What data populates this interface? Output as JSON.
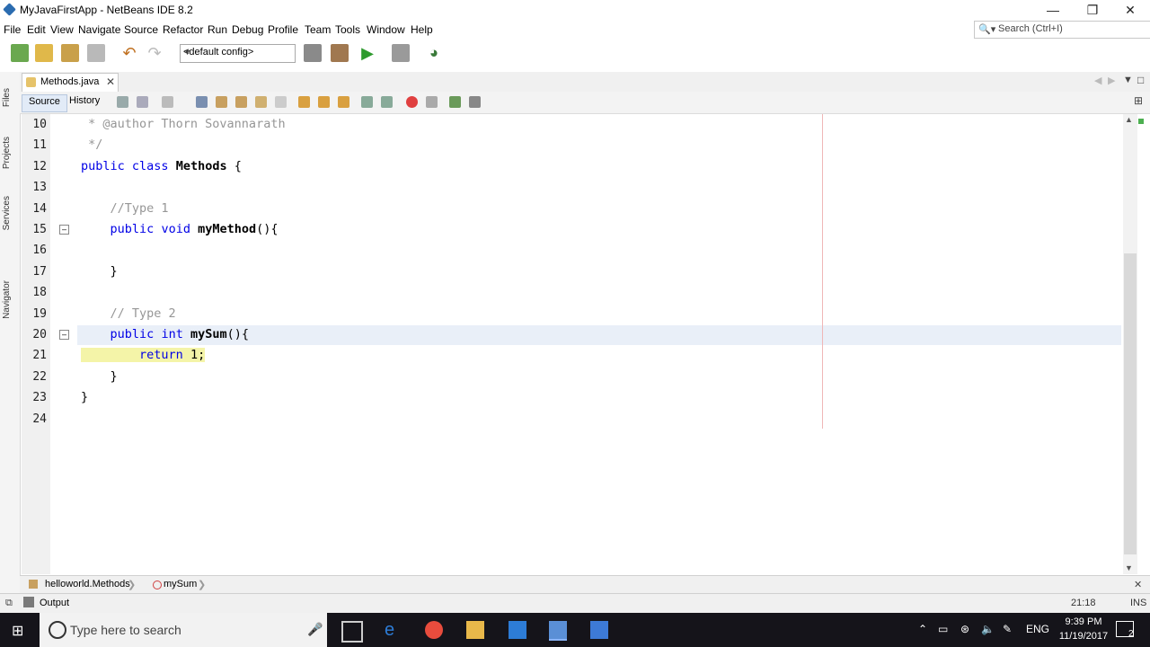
{
  "window": {
    "title": "MyJavaFirstApp - NetBeans IDE 8.2"
  },
  "menu": [
    "File",
    "Edit",
    "View",
    "Navigate",
    "Source",
    "Refactor",
    "Run",
    "Debug",
    "Profile",
    "Team",
    "Tools",
    "Window",
    "Help"
  ],
  "search": {
    "placeholder": "Search (Ctrl+I)"
  },
  "toolbar": {
    "config_value": "<default config>"
  },
  "side_panels": [
    "Files",
    "Projects",
    "Services",
    "Navigator"
  ],
  "editor": {
    "tab_label": "Methods.java",
    "source_tab": "Source",
    "history_tab": "History",
    "lines": [
      {
        "num": "10",
        "text": " * @author Thorn Sovannarath"
      },
      {
        "num": "11",
        "text": " */"
      },
      {
        "num": "12",
        "text": "public class Methods {"
      },
      {
        "num": "13",
        "text": ""
      },
      {
        "num": "14",
        "text": "    //Type 1"
      },
      {
        "num": "15",
        "text": "    public void myMethod(){"
      },
      {
        "num": "16",
        "text": ""
      },
      {
        "num": "17",
        "text": "    }"
      },
      {
        "num": "18",
        "text": ""
      },
      {
        "num": "19",
        "text": "    // Type 2"
      },
      {
        "num": "20",
        "text": "    public int mySum(){"
      },
      {
        "num": "21",
        "text": "        return 1;"
      },
      {
        "num": "22",
        "text": "    }"
      },
      {
        "num": "23",
        "text": "}"
      },
      {
        "num": "24",
        "text": ""
      }
    ]
  },
  "breadcrumb": {
    "class": "helloworld.Methods",
    "method": "mySum"
  },
  "output": {
    "label": "Output",
    "position": "21:18",
    "mode": "INS"
  },
  "taskbar": {
    "search_placeholder": "Type here to search",
    "lang": "ENG",
    "time": "9:39 PM",
    "date": "11/19/2017",
    "notifications": "2"
  }
}
